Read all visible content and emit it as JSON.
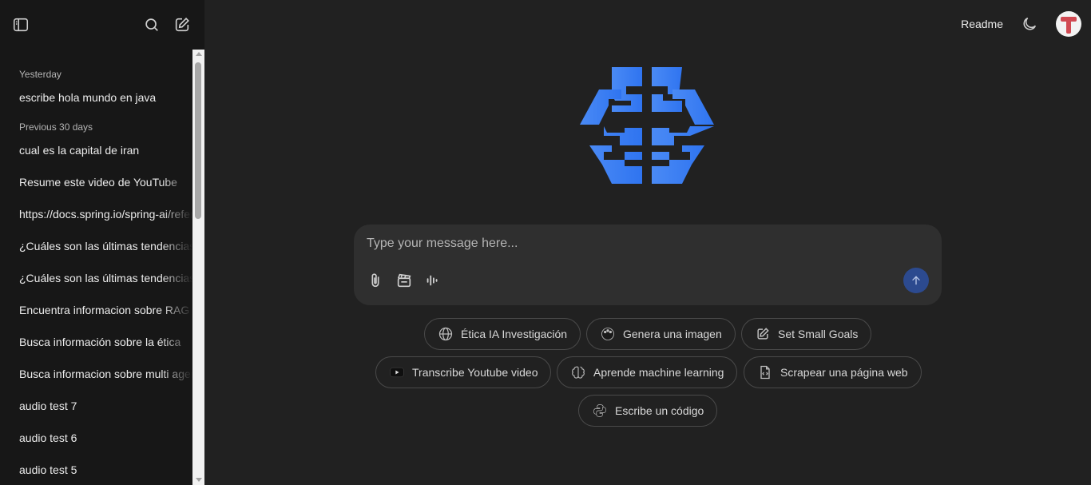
{
  "sidebar": {
    "groups": [
      {
        "title": "Yesterday",
        "items": [
          "escribe hola mundo en java"
        ]
      },
      {
        "title": "Previous 30 days",
        "items": [
          "cual es la capital de iran",
          "Resume este video de YouTube",
          "https://docs.spring.io/spring-ai/reference",
          "¿Cuáles son las últimas tendencias",
          "¿Cuáles son las últimas tendencias",
          "Encuentra informacion sobre RAG",
          "Busca información sobre la ética",
          "Busca informacion sobre multi agentes",
          "audio test 7",
          "audio test 6",
          "audio test 5"
        ]
      }
    ]
  },
  "header": {
    "readme_label": "Readme"
  },
  "composer": {
    "placeholder": "Type your message here..."
  },
  "suggestions": [
    "Ética IA Investigación",
    "Genera una imagen",
    "Set Small Goals",
    "Transcribe Youtube video",
    "Aprende machine learning",
    "Scrapear una página web",
    "Escribe un código"
  ],
  "colors": {
    "logo_blue": "#3b7ff5",
    "send_button": "#2c4a8f",
    "avatar_red": "#d14a53"
  }
}
